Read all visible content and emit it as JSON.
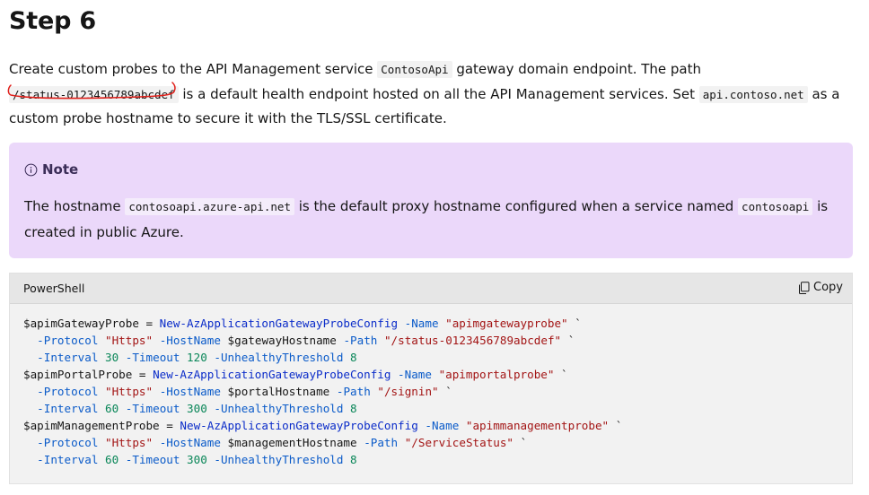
{
  "heading": "Step 6",
  "intro": {
    "text1": "Create custom probes to the API Management service ",
    "code1": "ContosoApi",
    "text2": " gateway domain endpoint. The path ",
    "code2": "/status-0123456789abcdef",
    "text3": " is a default health endpoint hosted on all the API Management services. Set ",
    "code3": "api.contoso.net",
    "text4": " as a custom probe hostname to secure it with the TLS/SSL certificate."
  },
  "note": {
    "title": "Note",
    "icon": "info-icon",
    "text1": "The hostname ",
    "code1": "contosoapi.azure-api.net",
    "text2": " is the default proxy hostname configured when a service named ",
    "code2": "contosoapi",
    "text3": " is created in public Azure."
  },
  "code_block": {
    "language": "PowerShell",
    "copy_label": "Copy",
    "copy_icon": "copy-icon",
    "lines": [
      [
        [
          "var",
          "$apimGatewayProbe"
        ],
        [
          "plain",
          " = "
        ],
        [
          "cmd",
          "New-AzApplicationGatewayProbeConfig"
        ],
        [
          "plain",
          " "
        ],
        [
          "param",
          "-Name"
        ],
        [
          "plain",
          " "
        ],
        [
          "str",
          "\"apimgatewayprobe\""
        ],
        [
          "plain",
          " `"
        ]
      ],
      [
        [
          "plain",
          "  "
        ],
        [
          "param",
          "-Protocol"
        ],
        [
          "plain",
          " "
        ],
        [
          "str",
          "\"Https\""
        ],
        [
          "plain",
          " "
        ],
        [
          "param",
          "-HostName"
        ],
        [
          "plain",
          " "
        ],
        [
          "var",
          "$gatewayHostname"
        ],
        [
          "plain",
          " "
        ],
        [
          "param",
          "-Path"
        ],
        [
          "plain",
          " "
        ],
        [
          "str",
          "\"/status-0123456789abcdef\""
        ],
        [
          "plain",
          " `"
        ]
      ],
      [
        [
          "plain",
          "  "
        ],
        [
          "param",
          "-Interval"
        ],
        [
          "plain",
          " "
        ],
        [
          "num",
          "30"
        ],
        [
          "plain",
          " "
        ],
        [
          "param",
          "-Timeout"
        ],
        [
          "plain",
          " "
        ],
        [
          "num",
          "120"
        ],
        [
          "plain",
          " "
        ],
        [
          "param",
          "-UnhealthyThreshold"
        ],
        [
          "plain",
          " "
        ],
        [
          "num",
          "8"
        ]
      ],
      [
        [
          "var",
          "$apimPortalProbe"
        ],
        [
          "plain",
          " = "
        ],
        [
          "cmd",
          "New-AzApplicationGatewayProbeConfig"
        ],
        [
          "plain",
          " "
        ],
        [
          "param",
          "-Name"
        ],
        [
          "plain",
          " "
        ],
        [
          "str",
          "\"apimportalprobe\""
        ],
        [
          "plain",
          " `"
        ]
      ],
      [
        [
          "plain",
          "  "
        ],
        [
          "param",
          "-Protocol"
        ],
        [
          "plain",
          " "
        ],
        [
          "str",
          "\"Https\""
        ],
        [
          "plain",
          " "
        ],
        [
          "param",
          "-HostName"
        ],
        [
          "plain",
          " "
        ],
        [
          "var",
          "$portalHostname"
        ],
        [
          "plain",
          " "
        ],
        [
          "param",
          "-Path"
        ],
        [
          "plain",
          " "
        ],
        [
          "str",
          "\"/signin\""
        ],
        [
          "plain",
          " `"
        ]
      ],
      [
        [
          "plain",
          "  "
        ],
        [
          "param",
          "-Interval"
        ],
        [
          "plain",
          " "
        ],
        [
          "num",
          "60"
        ],
        [
          "plain",
          " "
        ],
        [
          "param",
          "-Timeout"
        ],
        [
          "plain",
          " "
        ],
        [
          "num",
          "300"
        ],
        [
          "plain",
          " "
        ],
        [
          "param",
          "-UnhealthyThreshold"
        ],
        [
          "plain",
          " "
        ],
        [
          "num",
          "8"
        ]
      ],
      [
        [
          "var",
          "$apimManagementProbe"
        ],
        [
          "plain",
          " = "
        ],
        [
          "cmd",
          "New-AzApplicationGatewayProbeConfig"
        ],
        [
          "plain",
          " "
        ],
        [
          "param",
          "-Name"
        ],
        [
          "plain",
          " "
        ],
        [
          "str",
          "\"apimmanagementprobe\""
        ],
        [
          "plain",
          " `"
        ]
      ],
      [
        [
          "plain",
          "  "
        ],
        [
          "param",
          "-Protocol"
        ],
        [
          "plain",
          " "
        ],
        [
          "str",
          "\"Https\""
        ],
        [
          "plain",
          " "
        ],
        [
          "param",
          "-HostName"
        ],
        [
          "plain",
          " "
        ],
        [
          "var",
          "$managementHostname"
        ],
        [
          "plain",
          " "
        ],
        [
          "param",
          "-Path"
        ],
        [
          "plain",
          " "
        ],
        [
          "str",
          "\"/ServiceStatus\""
        ],
        [
          "plain",
          " `"
        ]
      ],
      [
        [
          "plain",
          "  "
        ],
        [
          "param",
          "-Interval"
        ],
        [
          "plain",
          " "
        ],
        [
          "num",
          "60"
        ],
        [
          "plain",
          " "
        ],
        [
          "param",
          "-Timeout"
        ],
        [
          "plain",
          " "
        ],
        [
          "num",
          "300"
        ],
        [
          "plain",
          " "
        ],
        [
          "param",
          "-UnhealthyThreshold"
        ],
        [
          "plain",
          " "
        ],
        [
          "num",
          "8"
        ]
      ]
    ]
  },
  "colors": {
    "note_background": "#ebd8fa",
    "annotation_red": "#e0201b",
    "code_command": "#0b2cc9",
    "code_string": "#a31515"
  }
}
